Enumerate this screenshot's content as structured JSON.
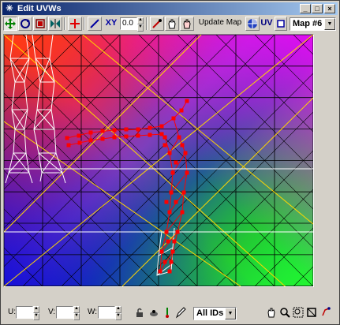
{
  "window": {
    "title": "Edit UVWs",
    "title_icon": "asterisk-icon",
    "controls": [
      "minimize",
      "maximize",
      "close"
    ]
  },
  "toolbar": {
    "tools": [
      {
        "name": "move-tool",
        "icon": "move-arrows-icon",
        "pressed": true
      },
      {
        "name": "rotate-tool",
        "icon": "rotate-icon",
        "pressed": false
      },
      {
        "name": "scale-tool",
        "icon": "scale-icon",
        "pressed": false
      },
      {
        "name": "mirror-tool",
        "icon": "mirror-icon",
        "pressed": false
      },
      {
        "name": "pin-tool",
        "icon": "red-plus-icon",
        "pressed": false
      },
      {
        "name": "pen-tool",
        "icon": "pencil-icon",
        "pressed": false
      },
      {
        "name": "weld-tool",
        "icon": "hand-icon",
        "pressed": false
      },
      {
        "name": "break-tool",
        "icon": "hand-icon",
        "pressed": false
      },
      {
        "name": "checker-tool",
        "icon": "checker-globe-icon",
        "pressed": false
      },
      {
        "name": "vertex-tool",
        "icon": "square-icon",
        "pressed": false
      }
    ],
    "axis_label": "XY",
    "value": "0.0",
    "update_map_label": "Update Map",
    "uv_label": "UV",
    "map_select": "Map #6",
    "colors": {
      "accent": "#0a246a",
      "accent_end": "#a6caf0",
      "face": "#d4d0c8"
    }
  },
  "bottom": {
    "u_label": "U:",
    "v_label": "V:",
    "w_label": "W:",
    "u_value": "",
    "v_value": "",
    "w_value": "",
    "ids_select": "All IDs",
    "nav_icons": [
      "pan-hand-icon",
      "zoom-icon",
      "zoom-region-icon",
      "zoom-extents-icon",
      "snap-icon"
    ]
  },
  "canvas": {
    "grid_color": "#000000",
    "selection_color": "#ff0000",
    "mesh_color": "#ffffff",
    "diagonal_color": "#ffd700"
  }
}
